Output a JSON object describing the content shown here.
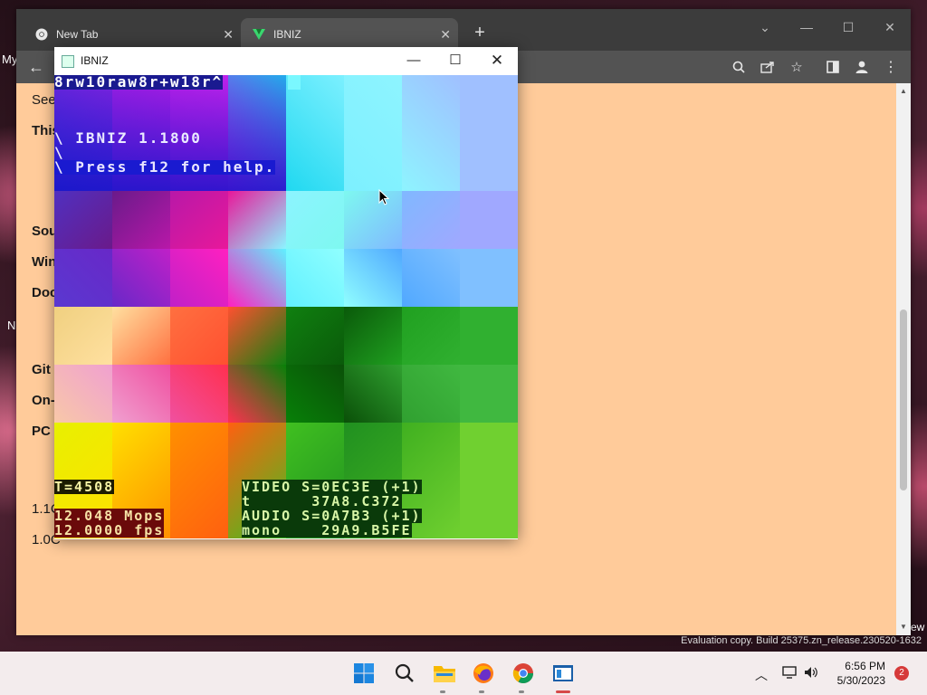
{
  "desktop": {
    "left_labels": [
      "My",
      "N"
    ],
    "right_label": "ew",
    "watermark": "Evaluation copy. Build 25375.zn_release.230520-1632"
  },
  "browser": {
    "tabs": [
      {
        "title": "New Tab",
        "icon": "chrome-icon"
      },
      {
        "title": "IBNIZ",
        "icon": "ibniz-v-icon"
      }
    ],
    "page_lines": [
      "See",
      "This",
      "Sou",
      "Win",
      "Doc",
      "Git",
      "On-",
      "PC",
      "1.1C",
      "1.0C"
    ]
  },
  "ibniz": {
    "window_title": "IBNIZ",
    "code_line": "8rw10raw8r+w18r^",
    "banner_line1": "\\ IBNIZ 1.1800 ",
    "banner_line2": "\\ Press f12 for help.",
    "banner_line3": "\\",
    "stats": {
      "t": "T=4508",
      "mops": "12.048 Mops",
      "fps": "12.0000 fps",
      "video": "VIDEO S=0EC3E (+1)",
      "video_t": "t      37A8.C372",
      "audio": "AUDIO S=0A7B3 (+1)",
      "audio_mono": "mono    29A9.B5FE"
    },
    "colors": {
      "r0": [
        "#4a2fd8",
        "#a020e0",
        "#d818e8",
        "#f020f0",
        "#20d8f0",
        "#7cf0ff",
        "#8ef4ff",
        "#a0c0ff"
      ],
      "r1": [
        "#5030c0",
        "#6a1a8a",
        "#b818a8",
        "#e8189a",
        "#8cf4ff",
        "#7ef8f0",
        "#80b8ff",
        "#a0a8ff"
      ],
      "r2": [
        "#5a38d0",
        "#6828c8",
        "#c020c8",
        "#ff20c0",
        "#60f0ff",
        "#90ffff",
        "#50a8ff",
        "#80c0ff"
      ],
      "r3": [
        "#f0d080",
        "#ffe0a0",
        "#ff7040",
        "#ff5030",
        "#108010",
        "#0a5a0a",
        "#20a020",
        "#30b030"
      ],
      "r4": [
        "#f8c8a8",
        "#f0a0d0",
        "#f050a0",
        "#ff3050",
        "#088008",
        "#0a5008",
        "#30a030",
        "#40b840"
      ],
      "r5": [
        "#e8f000",
        "#ffe000",
        "#ff9000",
        "#ff6010",
        "#40c020",
        "#209020",
        "#40b020",
        "#70d030"
      ]
    }
  },
  "taskbar": {
    "apps": [
      "start-icon",
      "search-icon",
      "file-explorer-icon",
      "firefox-icon",
      "chrome-icon",
      "ibniz-app-icon"
    ],
    "time": "6:56 PM",
    "date": "5/30/2023",
    "notification_count": "2"
  }
}
